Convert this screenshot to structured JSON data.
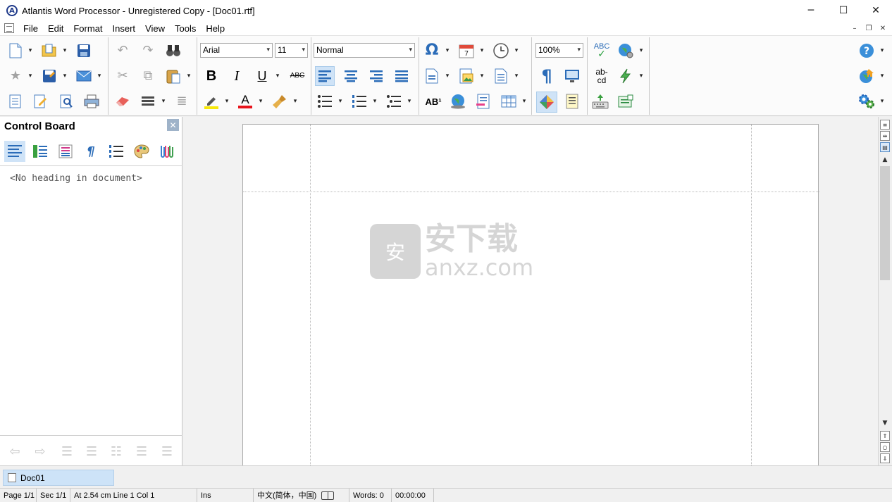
{
  "window": {
    "title": "Atlantis Word Processor - Unregistered Copy - [Doc01.rtf]",
    "app_icon_letter": "A",
    "controls": {
      "minimize": "─",
      "maximize": "☐",
      "close": "✕"
    }
  },
  "menu": {
    "items": [
      "File",
      "Edit",
      "Format",
      "Insert",
      "View",
      "Tools",
      "Help"
    ],
    "mdi_controls": {
      "minimize": "–",
      "restore": "❐",
      "close": "✕"
    }
  },
  "toolbar": {
    "font_name": "Arial",
    "font_size": "11",
    "style": "Normal",
    "zoom": "100%",
    "dropdown_glyph": "▾",
    "bold_label": "B",
    "italic_label": "I",
    "underline_label": "U",
    "strike_label": "ABC",
    "superscript_label": "AB¹",
    "hyphen_label": "ab-cd",
    "pilcrow": "¶",
    "omega": "Ω",
    "font_color_label": "A",
    "spellcheck_label": "ABC",
    "accent_color": "#1f5fb8"
  },
  "panel": {
    "title": "Control Board",
    "close_glyph": "✕",
    "empty_message": "<No heading in document>"
  },
  "watermark": {
    "cn_text": "安下载",
    "en_text": "anxz.com",
    "badge_text": "安"
  },
  "doc_tabs": [
    {
      "label": "Doc01",
      "active": true
    }
  ],
  "status": {
    "page": "Page 1/1",
    "section": "Sec 1/1",
    "position": "At 2.54 cm",
    "line": "Line 1",
    "col": "Col 1",
    "mode": "Ins",
    "language": "中文(简体，中国)",
    "words": "Words: 0",
    "time": "00:00:00"
  }
}
